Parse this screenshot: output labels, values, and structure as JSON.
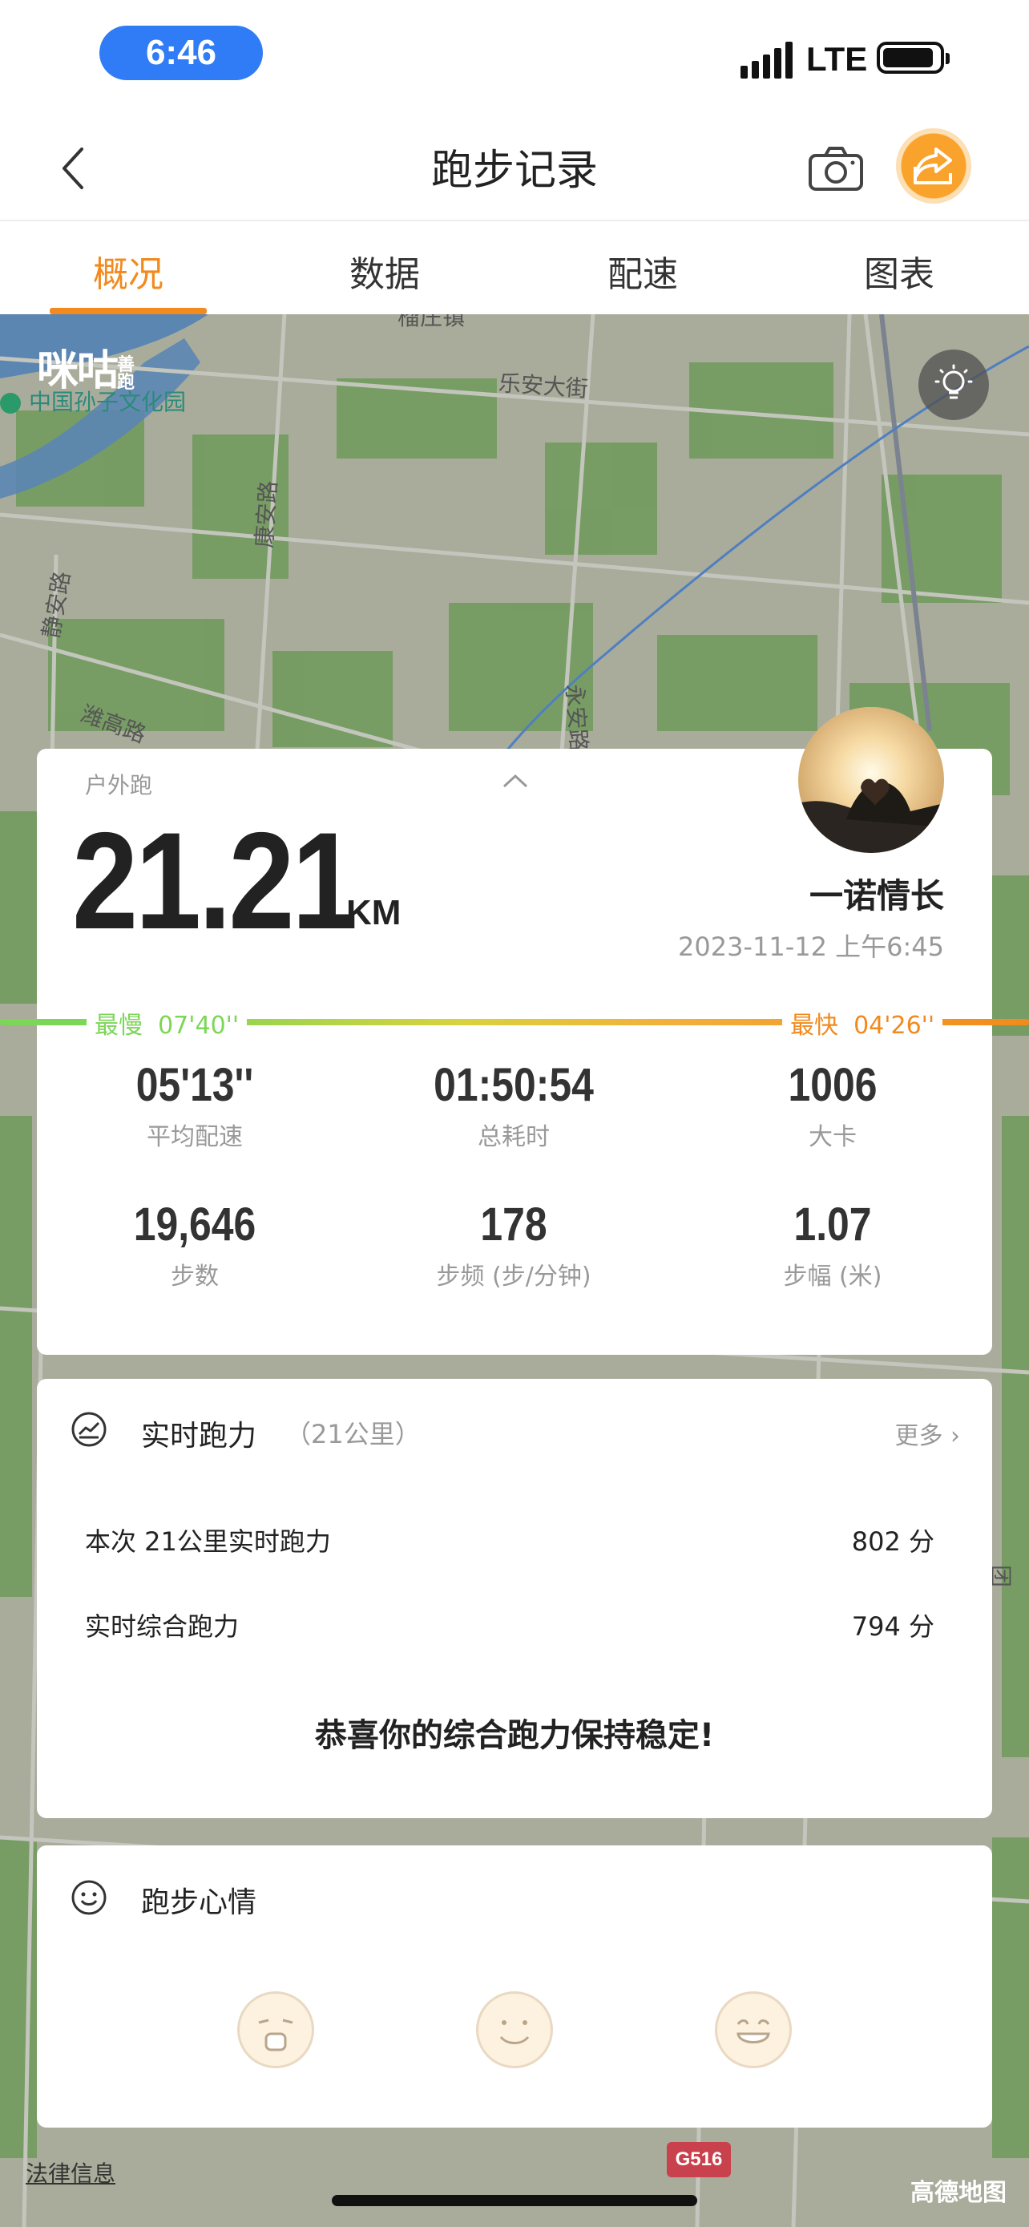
{
  "status_bar": {
    "time": "6:46",
    "network": "LTE"
  },
  "nav": {
    "title": "跑步记录"
  },
  "tabs": [
    {
      "label": "概况",
      "active": true
    },
    {
      "label": "数据",
      "active": false
    },
    {
      "label": "配速",
      "active": false
    },
    {
      "label": "图表",
      "active": false
    }
  ],
  "map": {
    "brand": "咪咕",
    "brand_sub": "善跑",
    "poi": "中国孙子文化园",
    "streets": [
      "乐安大街",
      "康安路",
      "静安路",
      "潍高路",
      "永安路",
      "团结路",
      "榴庄镇"
    ],
    "road_shield": "G516",
    "provider": "高德地图",
    "legal": "法律信息"
  },
  "summary": {
    "run_type": "户外跑",
    "distance": "21.21",
    "distance_unit": "KM",
    "nickname": "一诺情长",
    "datetime": "2023-11-12 上午6:45",
    "slowest_label": "最慢",
    "slowest_value": "07'40''",
    "fastest_label": "最快",
    "fastest_value": "04'26''",
    "stats": [
      {
        "value": "05'13''",
        "label": "平均配速"
      },
      {
        "value": "01:50:54",
        "label": "总耗时"
      },
      {
        "value": "1006",
        "label": "大卡"
      },
      {
        "value": "19,646",
        "label": "步数"
      },
      {
        "value": "178",
        "label": "步频 (步/分钟)"
      },
      {
        "value": "1.07",
        "label": "步幅 (米)"
      }
    ]
  },
  "power": {
    "title": "实时跑力",
    "subtitle": "（21公里）",
    "more": "更多 ›",
    "rows": [
      {
        "label": "本次 21公里实时跑力",
        "value": "802 分"
      },
      {
        "label": "实时综合跑力",
        "value": "794 分"
      }
    ],
    "message": "恭喜你的综合跑力保持稳定!"
  },
  "mood": {
    "title": "跑步心情"
  },
  "colors": {
    "accent": "#f28a1d",
    "slow": "#7cd657",
    "fast": "#f28a1d"
  }
}
